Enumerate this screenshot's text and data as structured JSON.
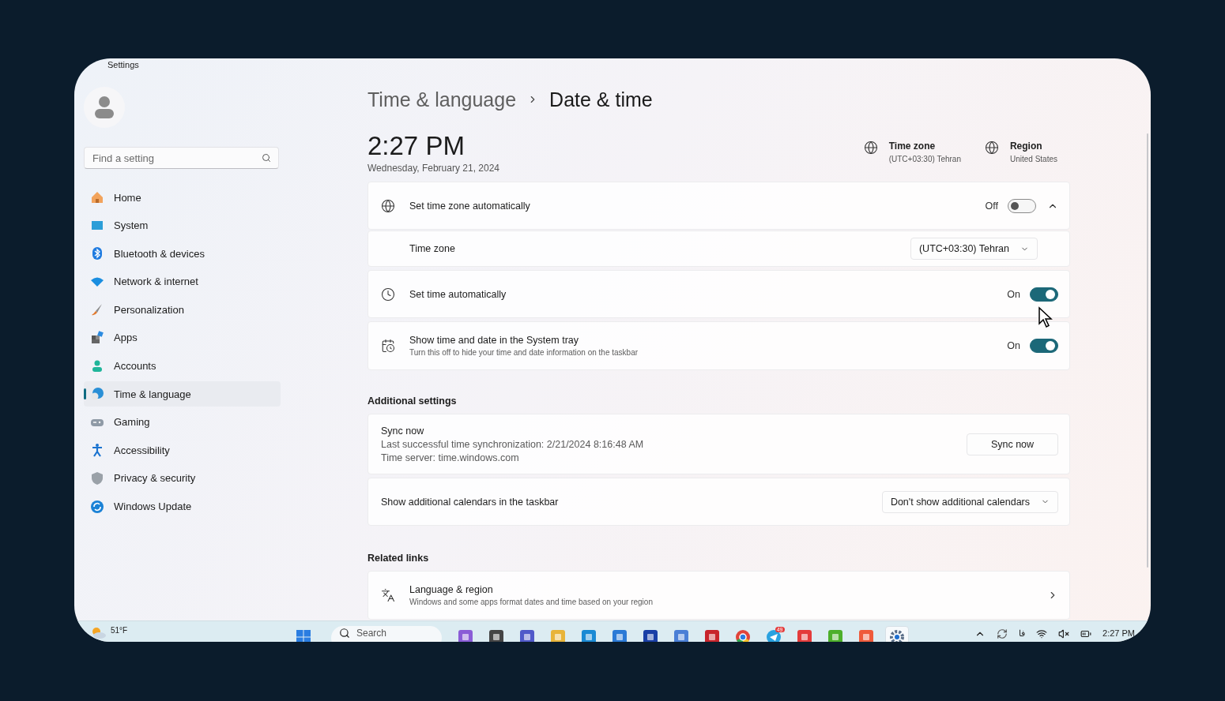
{
  "window": {
    "title": "Settings"
  },
  "sidebar": {
    "search": {
      "placeholder": "Find a setting"
    },
    "items": [
      {
        "label": "Home",
        "selected": false
      },
      {
        "label": "System",
        "selected": false
      },
      {
        "label": "Bluetooth & devices",
        "selected": false
      },
      {
        "label": "Network & internet",
        "selected": false
      },
      {
        "label": "Personalization",
        "selected": false
      },
      {
        "label": "Apps",
        "selected": false
      },
      {
        "label": "Accounts",
        "selected": false
      },
      {
        "label": "Time & language",
        "selected": true
      },
      {
        "label": "Gaming",
        "selected": false
      },
      {
        "label": "Accessibility",
        "selected": false
      },
      {
        "label": "Privacy & security",
        "selected": false
      },
      {
        "label": "Windows Update",
        "selected": false
      }
    ]
  },
  "breadcrumb": {
    "parent": "Time & language",
    "current": "Date & time"
  },
  "clock": {
    "time": "2:27 PM",
    "date": "Wednesday, February 21, 2024"
  },
  "summary": [
    {
      "title": "Time zone",
      "value": "(UTC+03:30) Tehran"
    },
    {
      "title": "Region",
      "value": "United States"
    }
  ],
  "settings": [
    {
      "label": "Set time zone automatically",
      "state_label": "Off",
      "on": false,
      "expanded": true,
      "children": [
        {
          "label": "Time zone",
          "value": "(UTC+03:30) Tehran"
        }
      ]
    },
    {
      "label": "Set time automatically",
      "state_label": "On",
      "on": true
    },
    {
      "label": "Show time and date in the System tray",
      "description": "Turn this off to hide your time and date information on the taskbar",
      "state_label": "On",
      "on": true
    }
  ],
  "additional": {
    "heading": "Additional settings",
    "items": [
      {
        "kind": "sync",
        "title": "Sync now",
        "lines": [
          "Last successful time synchronization: 2/21/2024 8:16:48 AM",
          "Time server: time.windows.com"
        ],
        "button": "Sync now"
      },
      {
        "kind": "dropdown",
        "title": "Show additional calendars in the taskbar",
        "value": "Don't show additional calendars"
      }
    ]
  },
  "related": {
    "heading": "Related links",
    "items": [
      {
        "title": "Language & region",
        "description": "Windows and some apps format dates and time based on your region"
      }
    ]
  },
  "taskbar": {
    "weather": "51°F",
    "search_placeholder": "Search",
    "apps": [
      {
        "active": false
      },
      {
        "active": false
      },
      {
        "active": false
      },
      {
        "active": false
      },
      {
        "active": false
      },
      {
        "active": false
      },
      {
        "active": false
      },
      {
        "active": false
      },
      {
        "active": false
      },
      {
        "active": false
      },
      {
        "active": false
      },
      {
        "active": false,
        "badge": "49"
      },
      {
        "active": false
      },
      {
        "active": false
      },
      {
        "active": false
      },
      {
        "active": true
      }
    ],
    "language": "فا",
    "time": "2:27 PM"
  }
}
